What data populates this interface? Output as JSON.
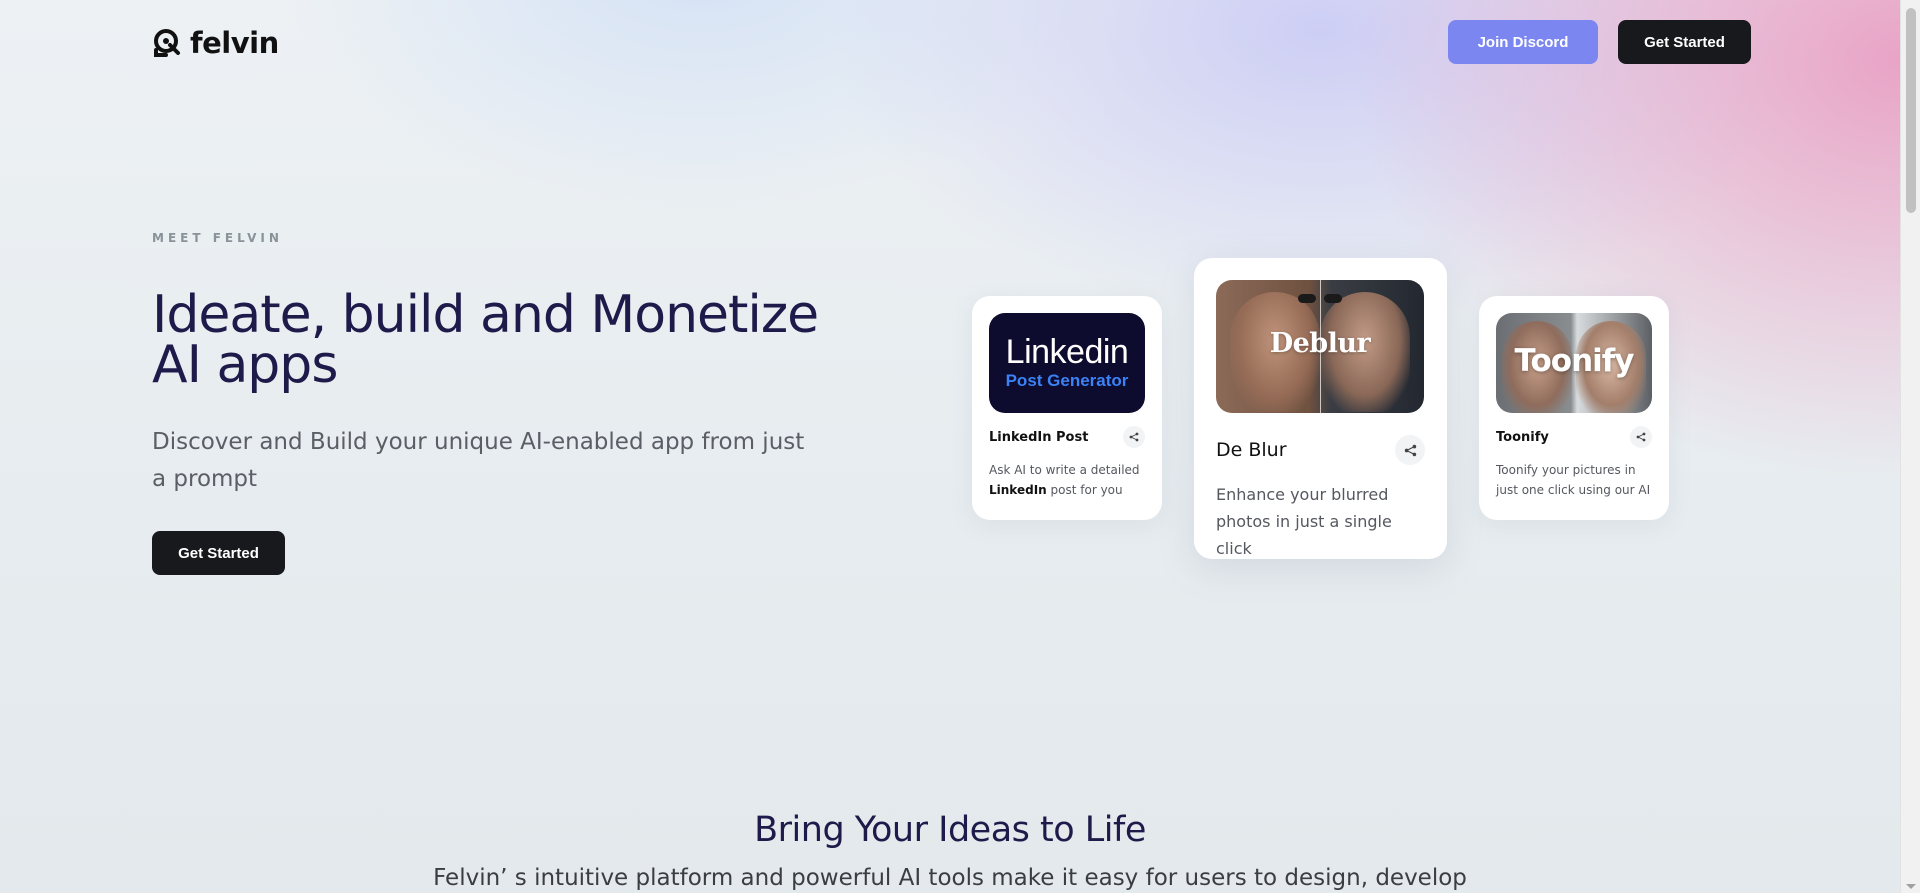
{
  "brand": {
    "name": "felvin"
  },
  "header": {
    "discord_label": "Join Discord",
    "start_label": "Get Started"
  },
  "hero": {
    "eyebrow": "MEET FELVIN",
    "title": "Ideate, build and Monetize AI apps",
    "subtitle": "Discover and Build your unique AI-enabled app from just a prompt",
    "cta_label": "Get Started"
  },
  "cards": [
    {
      "thumb_line1": "Linkedin",
      "thumb_line2": "Post Generator",
      "title": "LinkedIn Post",
      "desc_pre": "Ask AI to write a detailed ",
      "desc_bold": "LinkedIn",
      "desc_post": " post for you",
      "icon": "share-icon"
    },
    {
      "thumb_word": "Deblur",
      "title": "De Blur",
      "desc": "Enhance your blurred photos in just a single click",
      "icon": "share-icon"
    },
    {
      "thumb_word": "Toonify",
      "title": "Toonify",
      "desc": "Toonify your pictures in just one click using our AI",
      "icon": "share-icon"
    }
  ],
  "section2": {
    "title": "Bring Your Ideas to Life",
    "subtitle": "Felvin’ s intuitive platform and powerful AI tools make it easy for users to design, develop"
  },
  "colors": {
    "accent": "#7b86f0",
    "dark_button": "#18191d",
    "heading": "#1e1b4b"
  }
}
